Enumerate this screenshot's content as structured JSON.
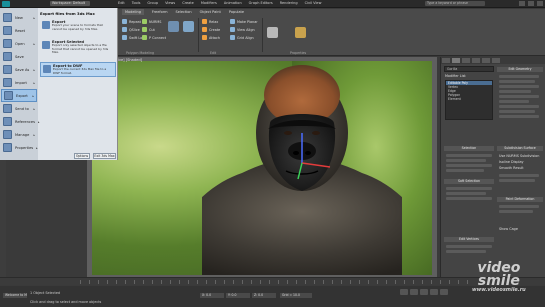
{
  "titlebar": {
    "title_pill": "Workspace: Default",
    "window_title": "Autodesk 3ds Max 2015",
    "search_placeholder": "Type a keyword or phrase",
    "menus": [
      "Edit",
      "Tools",
      "Group",
      "Views",
      "Create",
      "Modifiers",
      "Animation",
      "Graph Editors",
      "Rendering",
      "Civil View",
      "Customize",
      "Scripting",
      "Help"
    ]
  },
  "ribbon": {
    "tabs": [
      "Modeling",
      "Freeform",
      "Selection",
      "Object Paint",
      "Populate"
    ],
    "tools_col1": [
      "Repeat",
      "QSlice",
      "Swift Loop"
    ],
    "tools_col2": [
      "NURMS",
      "Cut",
      "P Connect"
    ],
    "tools_col3": [
      "Relax",
      "Create",
      "Attach"
    ],
    "tools_col4": [
      "Make Planar",
      "View Align",
      "Grid Align"
    ],
    "tools_col5": [
      "Use Displacement",
      "Hide Selected",
      "Unhide All"
    ],
    "tools_col6": [
      "Geometry (All)",
      "Subdivision",
      "Align"
    ],
    "panel_labels": [
      "Polygon Modeling",
      "Modify Selection",
      "Edit",
      "Geometry (All)",
      "Subdivision",
      "Align",
      "Properties"
    ]
  },
  "app_menu": {
    "items": [
      {
        "label": "New",
        "icon": "new-file-icon",
        "arrow": "▸"
      },
      {
        "label": "Reset",
        "icon": "reset-icon",
        "arrow": ""
      },
      {
        "label": "Open",
        "icon": "open-folder-icon",
        "arrow": "▸"
      },
      {
        "label": "Save",
        "icon": "save-icon",
        "arrow": ""
      },
      {
        "label": "Save As",
        "icon": "save-as-icon",
        "arrow": "▸"
      },
      {
        "label": "Import",
        "icon": "import-icon",
        "arrow": "▸"
      },
      {
        "label": "Export",
        "icon": "export-icon",
        "arrow": "▸"
      },
      {
        "label": "Send to",
        "icon": "send-to-icon",
        "arrow": "▸"
      },
      {
        "label": "References",
        "icon": "references-icon",
        "arrow": "▸"
      },
      {
        "label": "Manage",
        "icon": "manage-icon",
        "arrow": "▸"
      },
      {
        "label": "Properties",
        "icon": "properties-icon",
        "arrow": "▸"
      }
    ],
    "submenu_title": "Export files from 3ds Max",
    "submenu_items": [
      {
        "title": "Export",
        "desc": "Export your scene to formats that cannot be opened by 3ds Max."
      },
      {
        "title": "Export Selected",
        "desc": "Export only selected objects to a file format that cannot be opened by 3ds Max."
      },
      {
        "title": "Export to DWF",
        "desc": "Export the current 3ds Max file to a DWF format."
      }
    ],
    "options_button": "Options",
    "exit_button": "Exit 3ds Max"
  },
  "viewport": {
    "label": "[+] [Perspective] [Shaded]"
  },
  "command_panel": {
    "object_name": "Gorilla",
    "modifier_list": "Modifier List",
    "stack_items": [
      "Editable Poly",
      "Vertex",
      "Edge",
      "Polygon",
      "Element"
    ],
    "section_titles": [
      "Edit Geometry",
      "Subdivision Surface",
      "Paint Deformation",
      "Soft Selection",
      "Selection",
      "Edit Vertices"
    ],
    "checkbox_labels": [
      "Use NURMS Subdivision",
      "Isoline Display",
      "Smooth Result",
      "Show Cage"
    ]
  },
  "status": {
    "line1": "1 Object Selected",
    "line2": "Click and drag to select and move objects",
    "coords": [
      "X: 0.0",
      "Y: 0.0",
      "Z: 0.0",
      "Grid = 10.0"
    ],
    "welcome": "Welcome to M"
  },
  "watermark": {
    "line1": "video",
    "line2": "smile",
    "line3": "www.videosmile.ru"
  }
}
